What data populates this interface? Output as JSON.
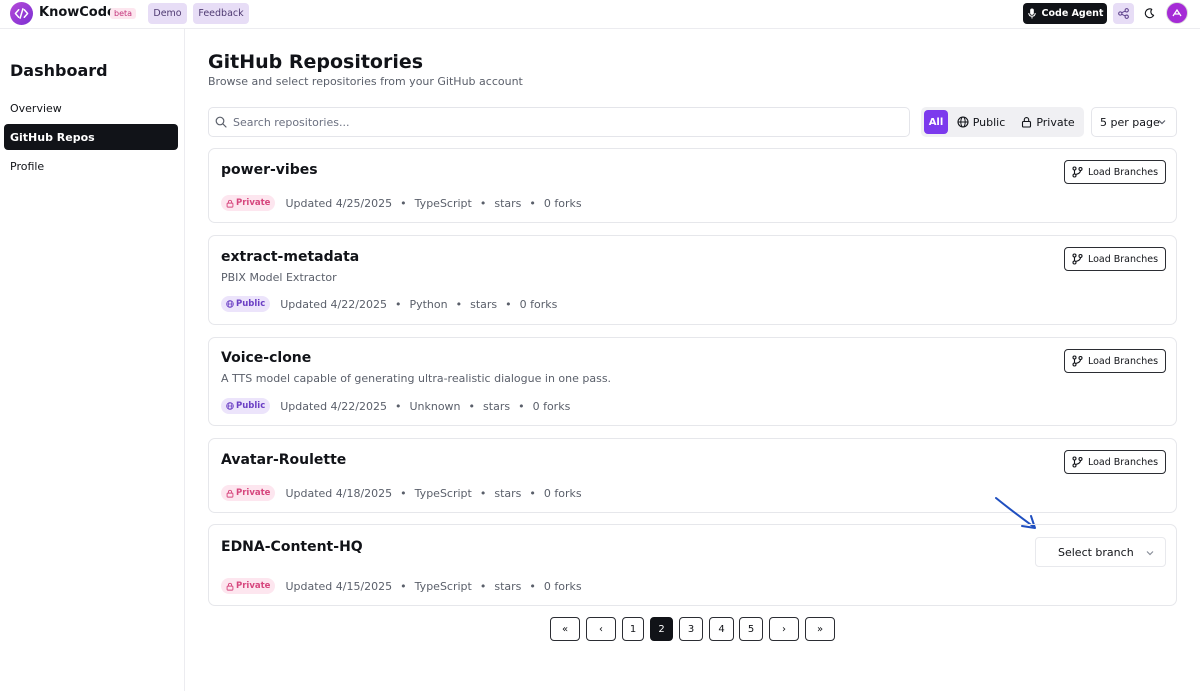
{
  "header": {
    "brand": "KnowCode",
    "beta": "beta",
    "demo_label": "Demo",
    "feedback_label": "Feedback",
    "code_agent_label": "Code Agent",
    "accent_color": "#7c3aed"
  },
  "sidebar": {
    "title": "Dashboard",
    "items": [
      {
        "label": "Overview",
        "active": false
      },
      {
        "label": "GitHub Repos",
        "active": true
      },
      {
        "label": "Profile",
        "active": false
      }
    ]
  },
  "main": {
    "title": "GitHub Repositories",
    "subtitle": "Browse and select repositories from your GitHub account",
    "search_placeholder": "Search repositories...",
    "filters": {
      "all": "All",
      "public": "Public",
      "private": "Private",
      "selected": "All"
    },
    "per_page": "5 per page"
  },
  "repos": [
    {
      "name": "power-vibes",
      "description": "",
      "visibility": "Private",
      "updated": "Updated 4/25/2025",
      "language": "TypeScript",
      "stars": "stars",
      "forks": "0 forks",
      "action": "Load Branches"
    },
    {
      "name": "extract-metadata",
      "description": "PBIX Model Extractor",
      "visibility": "Public",
      "updated": "Updated 4/22/2025",
      "language": "Python",
      "stars": "stars",
      "forks": "0 forks",
      "action": "Load Branches"
    },
    {
      "name": "Voice-clone",
      "description": "A TTS model capable of generating ultra-realistic dialogue in one pass.",
      "visibility": "Public",
      "updated": "Updated 4/22/2025",
      "language": "Unknown",
      "stars": "stars",
      "forks": "0 forks",
      "action": "Load Branches"
    },
    {
      "name": "Avatar-Roulette",
      "description": "",
      "visibility": "Private",
      "updated": "Updated 4/18/2025",
      "language": "TypeScript",
      "stars": "stars",
      "forks": "0 forks",
      "action": "Load Branches"
    },
    {
      "name": "EDNA-Content-HQ",
      "description": "",
      "visibility": "Private",
      "updated": "Updated 4/15/2025",
      "language": "TypeScript",
      "stars": "stars",
      "forks": "0 forks",
      "select_placeholder": "Select branch"
    }
  ],
  "pagination": {
    "first": "«",
    "prev": "‹",
    "pages": [
      "1",
      "2",
      "3",
      "4",
      "5"
    ],
    "current": "2",
    "next": "›",
    "last": "»"
  }
}
